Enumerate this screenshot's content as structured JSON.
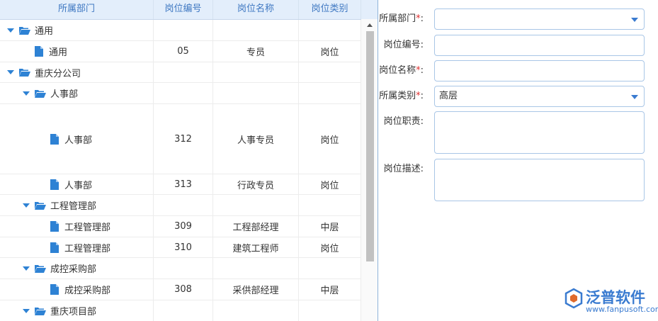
{
  "grid": {
    "columns": [
      "所属部门",
      "岗位编号",
      "岗位名称",
      "岗位类别"
    ],
    "rows": [
      {
        "dept": "通用",
        "level": 0,
        "kind": "folder",
        "code": "",
        "name": "",
        "category": ""
      },
      {
        "dept": "通用",
        "level": 1,
        "kind": "file",
        "code": "05",
        "name": "专员",
        "category": "岗位"
      },
      {
        "dept": "重庆分公司",
        "level": 0,
        "kind": "folder",
        "code": "",
        "name": "",
        "category": ""
      },
      {
        "dept": "人事部",
        "level": 1,
        "kind": "folder",
        "code": "",
        "name": "",
        "category": ""
      },
      {
        "dept": "人事部",
        "level": 2,
        "kind": "file",
        "code": "312",
        "name": "人事专员",
        "category": "岗位"
      },
      {
        "dept": "人事部",
        "level": 2,
        "kind": "file",
        "code": "313",
        "name": "行政专员",
        "category": "岗位"
      },
      {
        "dept": "工程管理部",
        "level": 1,
        "kind": "folder",
        "code": "",
        "name": "",
        "category": ""
      },
      {
        "dept": "工程管理部",
        "level": 2,
        "kind": "file",
        "code": "309",
        "name": "工程部经理",
        "category": "中层"
      },
      {
        "dept": "工程管理部",
        "level": 2,
        "kind": "file",
        "code": "310",
        "name": "建筑工程师",
        "category": "岗位"
      },
      {
        "dept": "成控采购部",
        "level": 1,
        "kind": "folder",
        "code": "",
        "name": "",
        "category": ""
      },
      {
        "dept": "成控采购部",
        "level": 2,
        "kind": "file",
        "code": "308",
        "name": "采供部经理",
        "category": "中层"
      },
      {
        "dept": "重庆项目部",
        "level": 1,
        "kind": "folder",
        "code": "",
        "name": "",
        "category": ""
      }
    ]
  },
  "form": {
    "dept_label": "所属部门",
    "dept_value": "",
    "code_label": "岗位编号",
    "code_value": "",
    "name_label": "岗位名称",
    "name_value": "",
    "category_label": "所属类别",
    "category_value": "高层",
    "duty_label": "岗位职责",
    "duty_value": "",
    "desc_label": "岗位描述",
    "desc_value": "",
    "required_mark": "*",
    "colon": ":"
  },
  "logo": {
    "name": "泛普软件",
    "url": "www.fanpusoft.com"
  },
  "colors": {
    "accent": "#3a7bd0",
    "header_bg": "#e3eefb",
    "required": "#e03030"
  }
}
